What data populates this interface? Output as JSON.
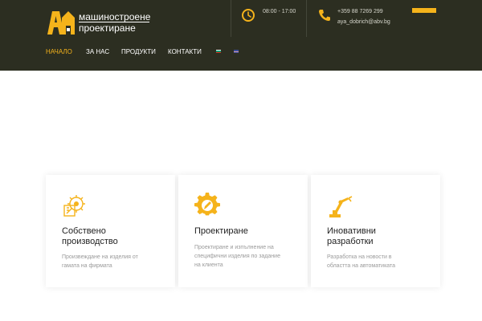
{
  "header": {
    "logo": {
      "line1": "машиностроене",
      "line2": "проектиране",
      "mark_letters": "АФ"
    },
    "hours": {
      "icon": "clock-icon",
      "text": "08:00 - 17:00"
    },
    "contact": {
      "icon": "phone-icon",
      "phone": "+359 88 7269 299",
      "email": "aya_dobrich@abv.bg"
    },
    "cta": {
      "label": ""
    }
  },
  "nav": {
    "items": [
      {
        "label": "НАЧАЛО",
        "active": true
      },
      {
        "label": "ЗА НАС",
        "active": false
      },
      {
        "label": "ПРОДУКТИ",
        "active": false
      },
      {
        "label": "КОНТАКТИ",
        "active": false
      }
    ],
    "languages": [
      {
        "icon": "bulgarian-flag-icon",
        "code": "bg"
      },
      {
        "icon": "english-flag-icon",
        "code": "en"
      }
    ]
  },
  "features": [
    {
      "icon": "gear-design-icon",
      "title_line1": "Собствено",
      "title_line2": "производство",
      "text_line1": "Произвеждане на изделия от",
      "text_line2": "гамата на фирмата",
      "text_line3": ""
    },
    {
      "icon": "gear-pen-icon",
      "title_line1": "Проектиране",
      "title_line2": "",
      "text_line1": "Проектиране и изпълнение на",
      "text_line2": "специфични изделия по задание",
      "text_line3": "на клиента"
    },
    {
      "icon": "robot-arm-icon",
      "title_line1": "Иновативни",
      "title_line2": "разработки",
      "text_line1": "Разработка на новости в",
      "text_line2": "областта на автоматиката",
      "text_line3": ""
    }
  ],
  "colors": {
    "header_bg": "#2c2e21",
    "accent": "#f5b31b",
    "card_title": "#1e1e1e",
    "card_text": "#9a9a9a"
  }
}
